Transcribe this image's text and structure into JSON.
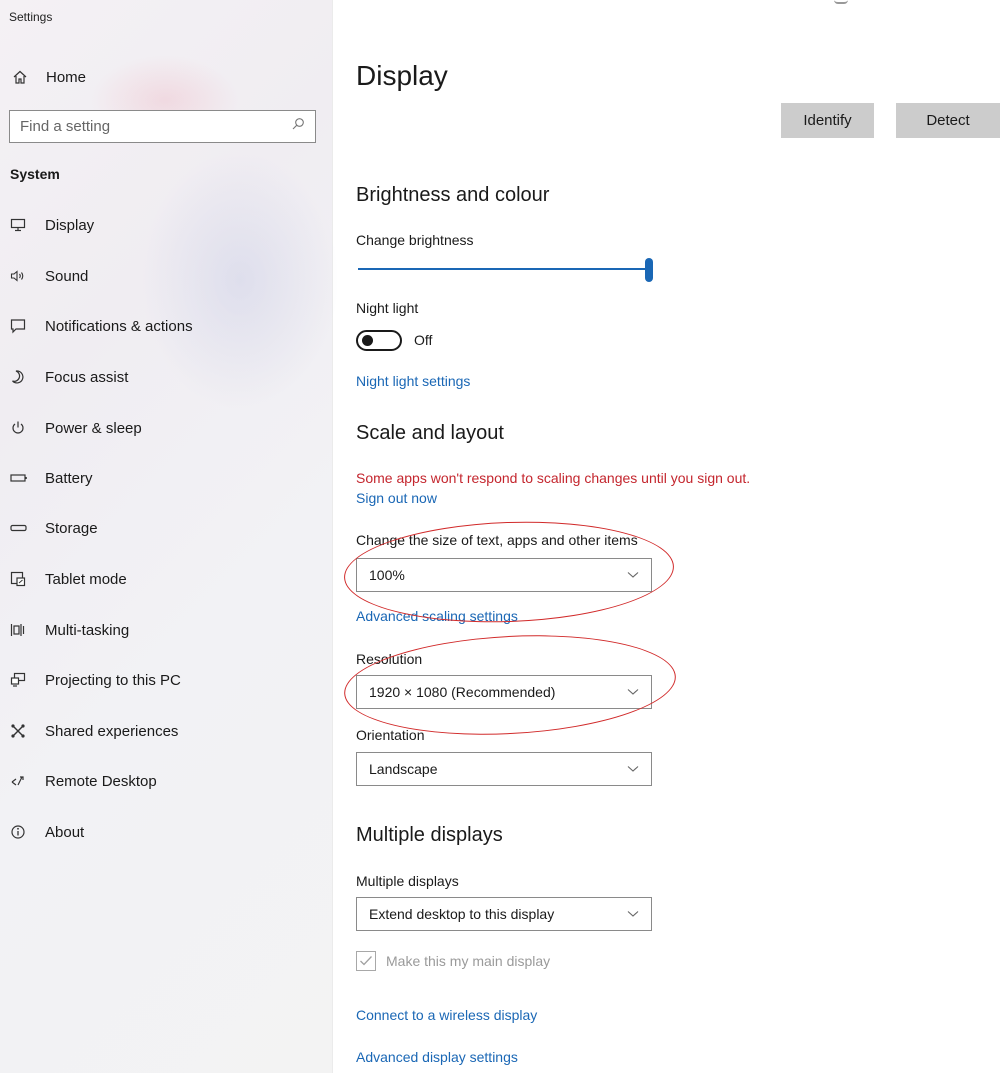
{
  "window": {
    "title": "Settings"
  },
  "sidebar": {
    "home_label": "Home",
    "search_placeholder": "Find a setting",
    "section_label": "System",
    "items": [
      {
        "label": "Display",
        "icon": "monitor-icon"
      },
      {
        "label": "Sound",
        "icon": "speaker-icon"
      },
      {
        "label": "Notifications & actions",
        "icon": "notification-icon"
      },
      {
        "label": "Focus assist",
        "icon": "moon-icon"
      },
      {
        "label": "Power & sleep",
        "icon": "power-icon"
      },
      {
        "label": "Battery",
        "icon": "battery-icon"
      },
      {
        "label": "Storage",
        "icon": "storage-icon"
      },
      {
        "label": "Tablet mode",
        "icon": "tablet-mode-icon"
      },
      {
        "label": "Multi-tasking",
        "icon": "multitasking-icon"
      },
      {
        "label": "Projecting to this PC",
        "icon": "projecting-icon"
      },
      {
        "label": "Shared experiences",
        "icon": "shared-experiences-icon"
      },
      {
        "label": "Remote Desktop",
        "icon": "remote-desktop-icon"
      },
      {
        "label": "About",
        "icon": "info-icon"
      }
    ]
  },
  "main": {
    "title": "Display",
    "identify_label": "Identify",
    "detect_label": "Detect",
    "brightness": {
      "heading": "Brightness and colour",
      "change_brightness_label": "Change brightness",
      "brightness_level": 1.0,
      "night_light_label": "Night light",
      "night_light_state": "Off",
      "night_light_settings_link": "Night light settings"
    },
    "scale": {
      "heading": "Scale and layout",
      "warning": "Some apps won't respond to scaling changes until you sign out.",
      "sign_out_link": "Sign out now",
      "size_label": "Change the size of text, apps and other items",
      "size_value": "100%",
      "advanced_scaling_link": "Advanced scaling settings",
      "resolution_label": "Resolution",
      "resolution_value": "1920 × 1080 (Recommended)",
      "orientation_label": "Orientation",
      "orientation_value": "Landscape"
    },
    "multiple": {
      "heading": "Multiple displays",
      "label": "Multiple displays",
      "value": "Extend desktop to this display",
      "main_display_label": "Make this my main display",
      "main_display_checked": true,
      "connect_wireless_link": "Connect to a wireless display",
      "advanced_display_link": "Advanced display settings"
    }
  },
  "colors": {
    "accent": "#1a67b5",
    "warning": "#c4262e",
    "annotation": "#d12a2a",
    "button_bg": "#cccccc"
  }
}
